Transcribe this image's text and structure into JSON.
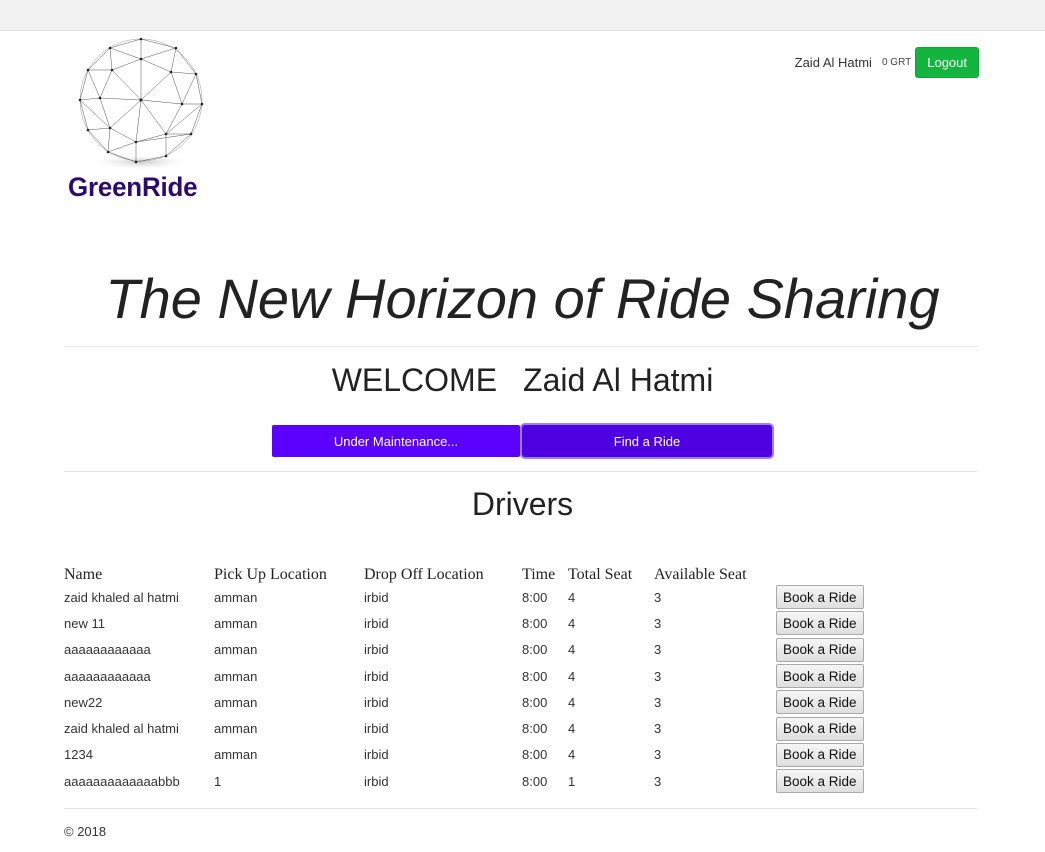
{
  "header": {
    "brand": "GreenRide",
    "user_name": "Zaid Al Hatmi",
    "balance": "0 GRT",
    "logout_label": "Logout"
  },
  "hero": {
    "tagline": "The New Horizon of Ride Sharing"
  },
  "welcome": {
    "prefix": "WELCOME",
    "name": "Zaid Al Hatmi"
  },
  "actions": {
    "maintenance_label": "Under Maintenance...",
    "find_ride_label": "Find a Ride"
  },
  "drivers": {
    "title": "Drivers",
    "columns": [
      "Name",
      "Pick Up Location",
      "Drop Off Location",
      "Time",
      "Total Seat",
      "Available Seat"
    ],
    "book_label": "Book a Ride",
    "rows": [
      {
        "name": "zaid khaled al hatmi",
        "pickup": "amman",
        "dropoff": "irbid",
        "time": "8:00",
        "total": "4",
        "available": "3"
      },
      {
        "name": "new 11",
        "pickup": "amman",
        "dropoff": "irbid",
        "time": "8:00",
        "total": "4",
        "available": "3"
      },
      {
        "name": "aaaaaaaaaaaa",
        "pickup": "amman",
        "dropoff": "irbid",
        "time": "8:00",
        "total": "4",
        "available": "3"
      },
      {
        "name": "aaaaaaaaaaaa",
        "pickup": "amman",
        "dropoff": "irbid",
        "time": "8:00",
        "total": "4",
        "available": "3"
      },
      {
        "name": "new22",
        "pickup": "amman",
        "dropoff": "irbid",
        "time": "8:00",
        "total": "4",
        "available": "3"
      },
      {
        "name": "zaid khaled al hatmi",
        "pickup": "amman",
        "dropoff": "irbid",
        "time": "8:00",
        "total": "4",
        "available": "3"
      },
      {
        "name": "1234",
        "pickup": "amman",
        "dropoff": "irbid",
        "time": "8:00",
        "total": "4",
        "available": "3"
      },
      {
        "name": "aaaaaaaaaaaaabbb",
        "pickup": "1",
        "dropoff": "irbid",
        "time": "8:00",
        "total": "1",
        "available": "3"
      }
    ]
  },
  "footer": {
    "copyright": "© 2018"
  },
  "colors": {
    "brand": "#2d0b6b",
    "logout": "#14b53e",
    "primary_button": "#5b00ff"
  }
}
